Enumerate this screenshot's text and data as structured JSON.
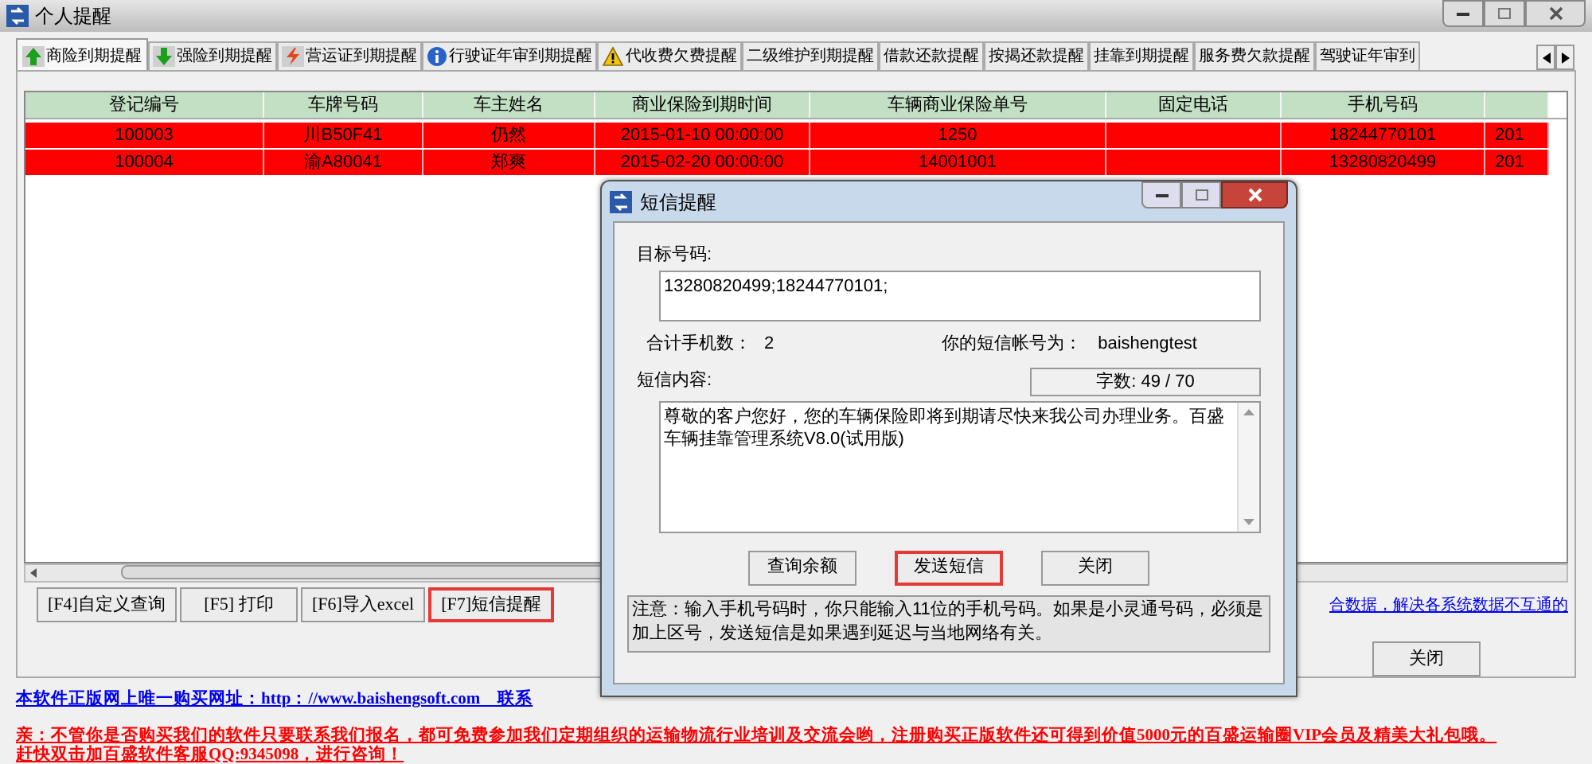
{
  "window": {
    "title": "个人提醒"
  },
  "tabs": [
    {
      "label": "商险到期提醒",
      "kind": "up",
      "selected": true
    },
    {
      "label": "强险到期提醒",
      "kind": "down",
      "selected": false
    },
    {
      "label": "营运证到期提醒",
      "kind": "bolt",
      "selected": false
    },
    {
      "label": "行驶证年审到期提醒",
      "kind": "info",
      "selected": false
    },
    {
      "label": "代收费欠费提醒",
      "kind": "warn",
      "selected": false
    },
    {
      "label": "二级维护到期提醒",
      "selected": false
    },
    {
      "label": "借款还款提醒",
      "selected": false
    },
    {
      "label": "按揭还款提醒",
      "selected": false
    },
    {
      "label": "挂靠到期提醒",
      "selected": false
    },
    {
      "label": "服务费欠款提醒",
      "selected": false
    },
    {
      "label": "驾驶证年审到",
      "selected": false
    }
  ],
  "table": {
    "columns": [
      "登记编号",
      "车牌号码",
      "车主姓名",
      "商业保险到期时间",
      "车辆商业保险单号",
      "固定电话",
      "手机号码"
    ],
    "rows": [
      {
        "overdue": true,
        "cells": [
          "100003",
          "川B50F41",
          "仍然",
          "2015-01-10 00:00:00",
          "1250",
          "",
          "18244770101"
        ],
        "column_8": "201"
      },
      {
        "overdue": true,
        "cells": [
          "100004",
          "渝A80041",
          "郑爽",
          "2015-02-20 00:00:00",
          "14001001",
          "",
          "13280820499"
        ],
        "column_8": "201"
      }
    ]
  },
  "toolbar_buttons": [
    {
      "label": "[F4]自定义查询",
      "highlighted": false
    },
    {
      "label": "[F5] 打印",
      "highlighted": false
    },
    {
      "label": "[F6]导入excel",
      "highlighted": false
    },
    {
      "label": "[F7]短信提醒",
      "highlighted": true
    }
  ],
  "side_link": "合数据，解决各系统数据不互通的",
  "close_button": "关闭",
  "purchase_link": "本软件正版网上唯一购买网址：http：//www.baishengsoft.com　联系",
  "promo_link": "亲：不管你是否购买我们的软件只要联系我们报名，都可免费参加我们定期组织的运输物流行业培训及交流会哟，注册购买正版软件还可得到价值5000元的百盛运输圈VIP会员及精美大礼包哦。",
  "promo_link_2": "赶快双击加百盛软件客服QQ:9345098，进行咨询！",
  "dialog": {
    "title": "短信提醒",
    "target_label": "目标号码:",
    "target_value": "13280820499;18244770101;",
    "count_label": "合计手机数：",
    "count_value": "2",
    "account_label": "你的短信帐号为：",
    "account_value": "baishengtest",
    "content_label": "短信内容:",
    "char_count": "字数: 49 / 70",
    "content_value": "尊敬的客户您好，您的车辆保险即将到期请尽快来我公司办理业务。百盛车辆挂靠管理系统V8.0(试用版)",
    "buttons": [
      {
        "label": "查询余额",
        "highlighted": false
      },
      {
        "label": "发送短信",
        "highlighted": true
      },
      {
        "label": "关闭",
        "highlighted": false
      }
    ],
    "note": "注意：输入手机号码时，你只能输入11位的手机号码。如果是小灵通号码，必须是加上区号，发送短信是如果遇到延迟与当地网络有关。"
  }
}
